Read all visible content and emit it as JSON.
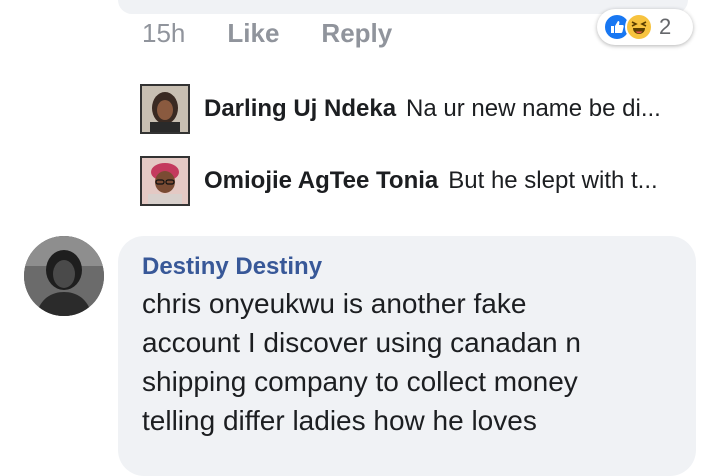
{
  "comment_actions": {
    "timestamp": "15h",
    "like_label": "Like",
    "reply_label": "Reply"
  },
  "reactions": {
    "icons": [
      "like-icon",
      "haha-icon"
    ],
    "count": "2",
    "colors": {
      "like": "#1877f2",
      "haha": "#f7c33f"
    }
  },
  "replies": [
    {
      "name": "Darling Uj Ndeka",
      "text": "Na ur new name be di..."
    },
    {
      "name": "Omiojie AgTee Tonia",
      "text": "But he slept with t..."
    }
  ],
  "comment": {
    "author": "Destiny Destiny",
    "text": "chris onyeukwu is another fake\naccount I discover using canadan n\nshipping company to collect money\ntelling differ ladies how he loves"
  }
}
